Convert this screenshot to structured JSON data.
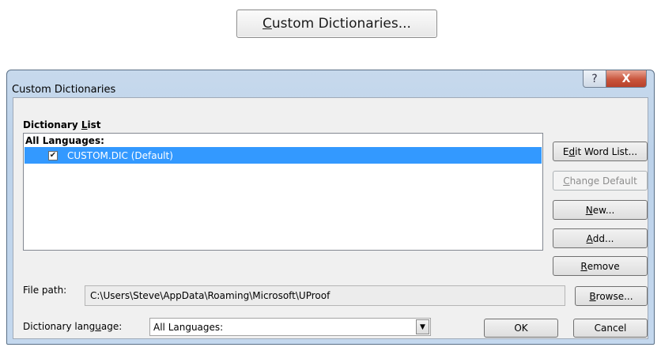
{
  "top_button": {
    "prefix": "C",
    "rest": "ustom Dictionaries..."
  },
  "dialog": {
    "title": "Custom Dictionaries",
    "help_glyph": "?",
    "close_glyph": "X",
    "dictionary_list": {
      "label_prefix": "Dictionary ",
      "label_accel": "L",
      "label_suffix": "ist",
      "group_label": "All Languages:",
      "items": [
        {
          "name": "CUSTOM.DIC (Default)",
          "checked": true,
          "selected": true
        }
      ]
    },
    "buttons": {
      "edit_word_list": {
        "pre": "E",
        "accel": "d",
        "post": "it Word List..."
      },
      "change_default": {
        "pre": "",
        "accel": "C",
        "post": "hange Default"
      },
      "new": {
        "pre": "",
        "accel": "N",
        "post": "ew..."
      },
      "add": {
        "pre": "",
        "accel": "A",
        "post": "dd..."
      },
      "remove": {
        "pre": "",
        "accel": "R",
        "post": "emove"
      },
      "browse": {
        "pre": "",
        "accel": "B",
        "post": "rowse..."
      },
      "ok": "OK",
      "cancel": "Cancel"
    },
    "file_path": {
      "label": "File path:",
      "value": "C:\\Users\\Steve\\AppData\\Roaming\\Microsoft\\UProof"
    },
    "dictionary_language": {
      "label_pre": "Dictionary lang",
      "label_accel": "u",
      "label_post": "age:",
      "selected": "All Languages:"
    },
    "colors": {
      "selection": "#3399ff",
      "close_button": "#c9553c",
      "frame": "#bcd2ea"
    }
  }
}
